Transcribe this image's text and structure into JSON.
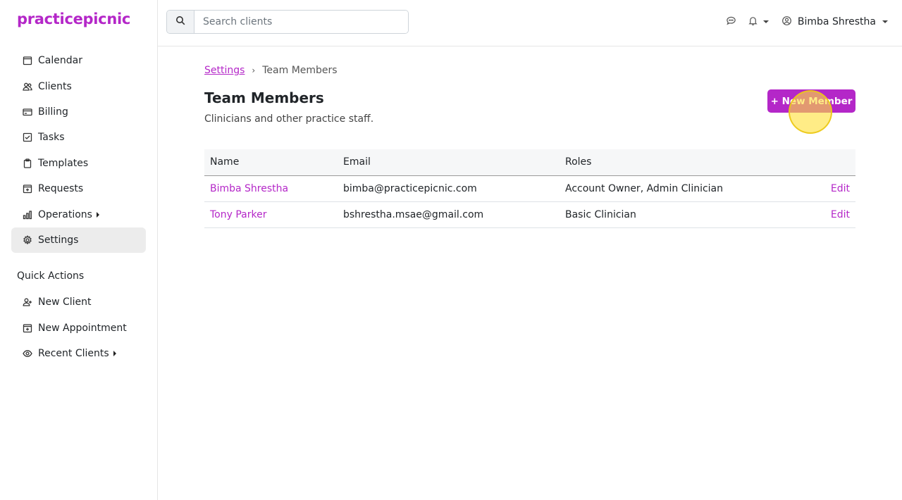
{
  "app": {
    "logo": "practicepicnic"
  },
  "sidebar": {
    "items": [
      {
        "label": "Calendar",
        "icon": "calendar-icon"
      },
      {
        "label": "Clients",
        "icon": "users-icon"
      },
      {
        "label": "Billing",
        "icon": "credit-card-icon"
      },
      {
        "label": "Tasks",
        "icon": "checkbox-icon"
      },
      {
        "label": "Templates",
        "icon": "clipboard-icon"
      },
      {
        "label": "Requests",
        "icon": "plus-square-icon"
      },
      {
        "label": "Operations",
        "icon": "bar-chart-icon",
        "has_submenu": true
      },
      {
        "label": "Settings",
        "icon": "gear-icon",
        "active": true
      }
    ],
    "quick_actions_title": "Quick Actions",
    "quick_actions": [
      {
        "label": "New Client",
        "icon": "user-plus-icon"
      },
      {
        "label": "New Appointment",
        "icon": "calendar-plus-icon"
      },
      {
        "label": "Recent Clients",
        "icon": "eye-icon",
        "has_submenu": true
      }
    ]
  },
  "topbar": {
    "search_placeholder": "Search clients",
    "user_name": "Bimba Shrestha"
  },
  "breadcrumb": {
    "parent": "Settings",
    "current": "Team Members"
  },
  "page": {
    "title": "Team Members",
    "subtitle": "Clinicians and other practice staff.",
    "new_button": "+ New Member"
  },
  "table": {
    "headers": [
      "Name",
      "Email",
      "Roles",
      ""
    ],
    "rows": [
      {
        "name": "Bimba Shrestha",
        "email": "bimba@practicepicnic.com",
        "roles": "Account Owner, Admin Clinician",
        "action": "Edit"
      },
      {
        "name": "Tony Parker",
        "email": "bshrestha.msae@gmail.com",
        "roles": "Basic Clinician",
        "action": "Edit"
      }
    ]
  },
  "colors": {
    "brand": "#b427c8",
    "active_nav_bg": "#ececec"
  }
}
